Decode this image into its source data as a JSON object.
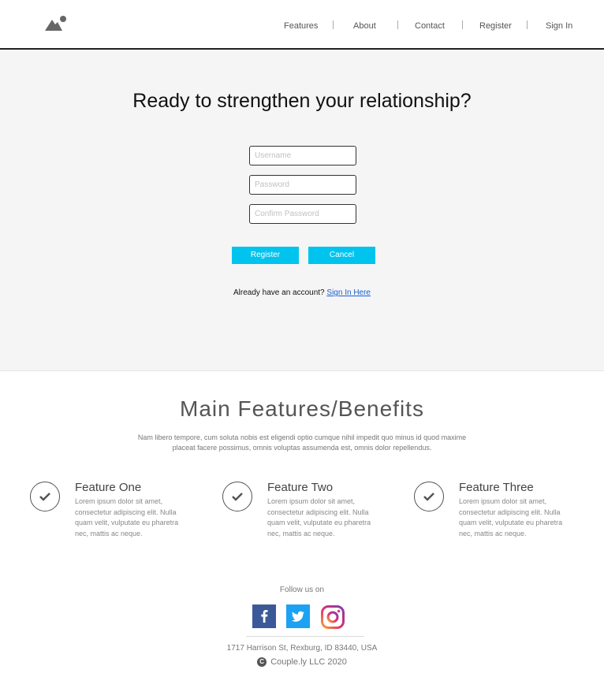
{
  "header": {
    "logo_icon": "image-placeholder-icon",
    "nav": [
      {
        "label": "Features"
      },
      {
        "label": "About"
      },
      {
        "label": "Contact"
      },
      {
        "label": "Register"
      },
      {
        "label": "Sign In"
      }
    ]
  },
  "hero": {
    "title": "Ready to strengthen your relationship?",
    "username_placeholder": "Username",
    "password_placeholder": "Password",
    "confirm_placeholder": "Confirm Password",
    "register_label": "Register",
    "cancel_label": "Cancel",
    "account_prompt": "Already have an account?",
    "signin_link": "Sign In Here",
    "accent_color": "#00c4ee"
  },
  "features": {
    "title": "Main Features/Benefits",
    "description": "Nam libero tempore, cum soluta nobis est eligendi optio cumque nihil impedit quo minus id quod maxime placeat facere possimus, omnis voluptas assumenda est, omnis dolor repellendus.",
    "items": [
      {
        "title": "Feature One",
        "text": "Lorem ipsum dolor sit amet, consectetur adipiscing elit. Nulla quam velit, vulputate eu pharetra nec, mattis ac neque."
      },
      {
        "title": "Feature Two",
        "text": "Lorem ipsum dolor sit amet, consectetur adipiscing elit. Nulla quam velit, vulputate eu pharetra nec, mattis ac neque."
      },
      {
        "title": "Feature Three",
        "text": "Lorem ipsum dolor sit amet, consectetur adipiscing elit. Nulla quam velit, vulputate eu pharetra nec, mattis ac neque."
      }
    ]
  },
  "footer": {
    "follow_label": "Follow us on",
    "social": [
      {
        "icon": "facebook-icon",
        "color": "#3b5998"
      },
      {
        "icon": "twitter-icon",
        "color": "#1da1f2"
      },
      {
        "icon": "instagram-icon",
        "color": "#c13584"
      }
    ],
    "address": "1717 Harrison St, Rexburg, ID 83440, USA",
    "copyright": "Couple.ly LLC 2020"
  }
}
